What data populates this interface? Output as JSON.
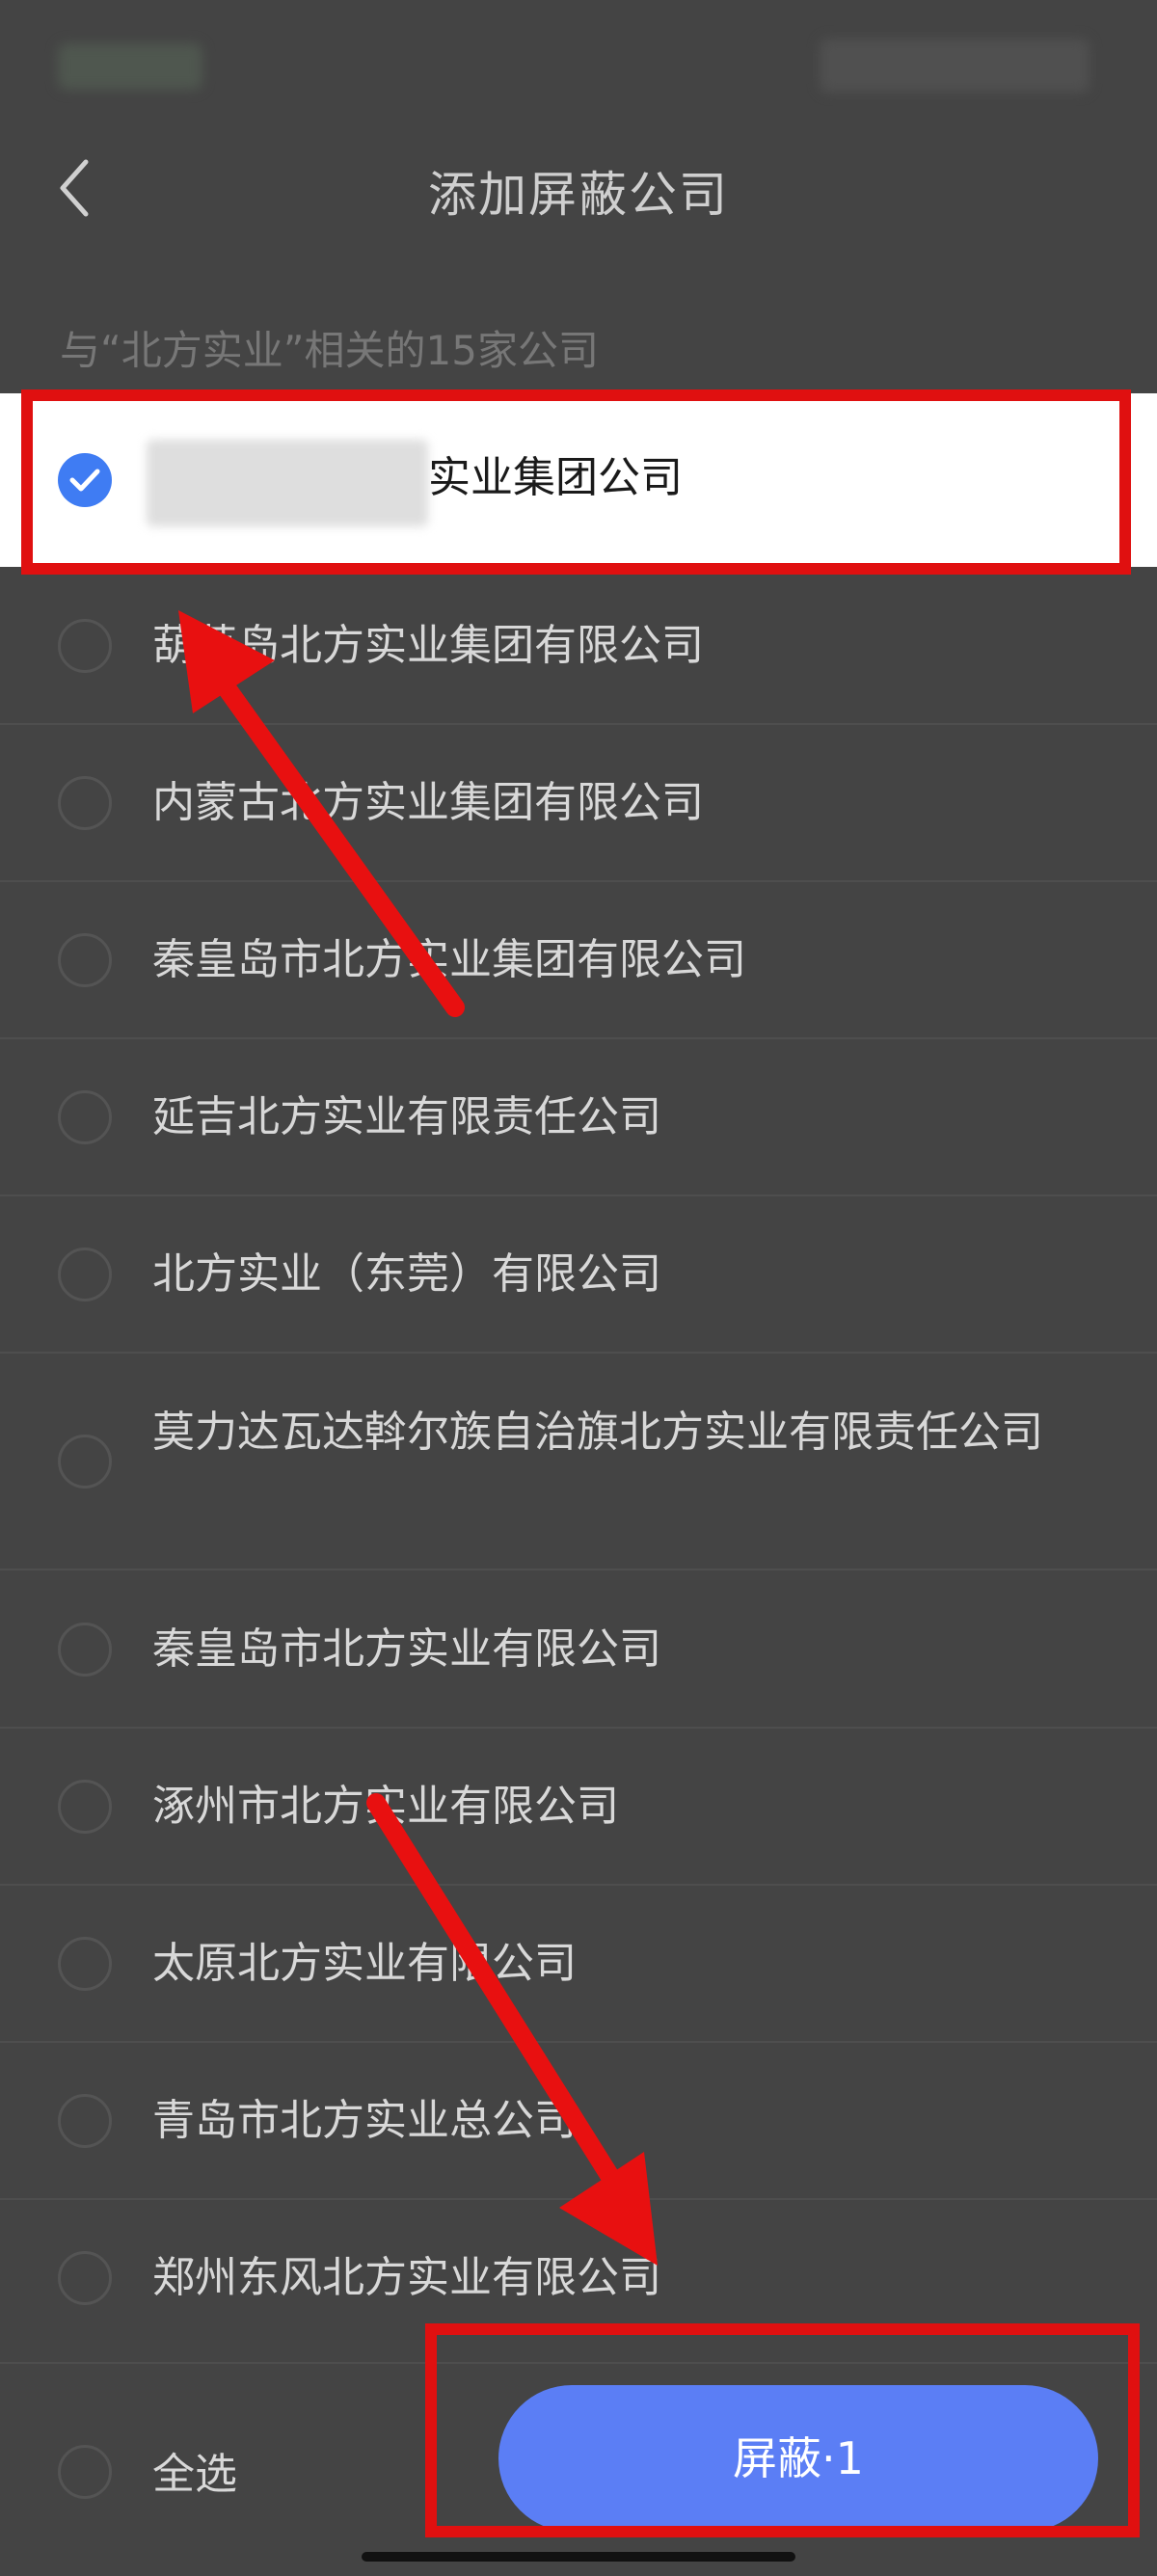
{
  "header": {
    "title": "添加屏蔽公司"
  },
  "subtitle": "与“北方实业”相关的15家公司",
  "companies": [
    {
      "name": "实业集团公司",
      "selected": true
    },
    {
      "name": "葫芦岛北方实业集团有限公司",
      "selected": false
    },
    {
      "name": "内蒙古北方实业集团有限公司",
      "selected": false
    },
    {
      "name": "秦皇岛市北方实业集团有限公司",
      "selected": false
    },
    {
      "name": "延吉北方实业有限责任公司",
      "selected": false
    },
    {
      "name": "北方实业（东莞）有限公司",
      "selected": false
    },
    {
      "name": "莫力达瓦达斡尔族自治旗北方实业有限责任公司",
      "selected": false
    },
    {
      "name": "秦皇岛市北方实业有限公司",
      "selected": false
    },
    {
      "name": "涿州市北方实业有限公司",
      "selected": false
    },
    {
      "name": "太原北方实业有限公司",
      "selected": false
    },
    {
      "name": "青岛市北方实业总公司",
      "selected": false
    },
    {
      "name": "郑州东风北方实业有限公司",
      "selected": false
    }
  ],
  "footer": {
    "select_all_label": "全选",
    "confirm_label": "屏蔽·1"
  },
  "colors": {
    "accent": "#5b7ef5",
    "checkbox": "#3f7cf3",
    "highlight": "#e01010",
    "background": "#444444"
  },
  "icons": {
    "back": "chevron-left-icon",
    "check": "check-icon",
    "arrow": "arrow-icon"
  }
}
